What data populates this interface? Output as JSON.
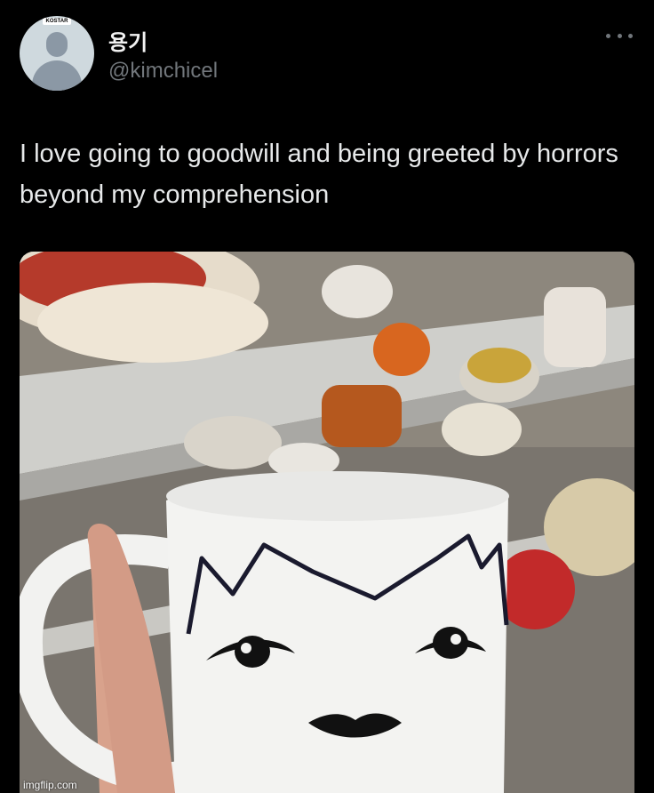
{
  "tweet": {
    "avatar_badge": "KOSTAR",
    "display_name": "용기",
    "handle": "@kimchicel",
    "more_icon": "more-dots-icon",
    "text": "I love going to goodwill and being greeted by horrors beyond my comprehension"
  },
  "media": {
    "description_icon": "photo-mug-face",
    "watermark": "imgflip.com"
  }
}
